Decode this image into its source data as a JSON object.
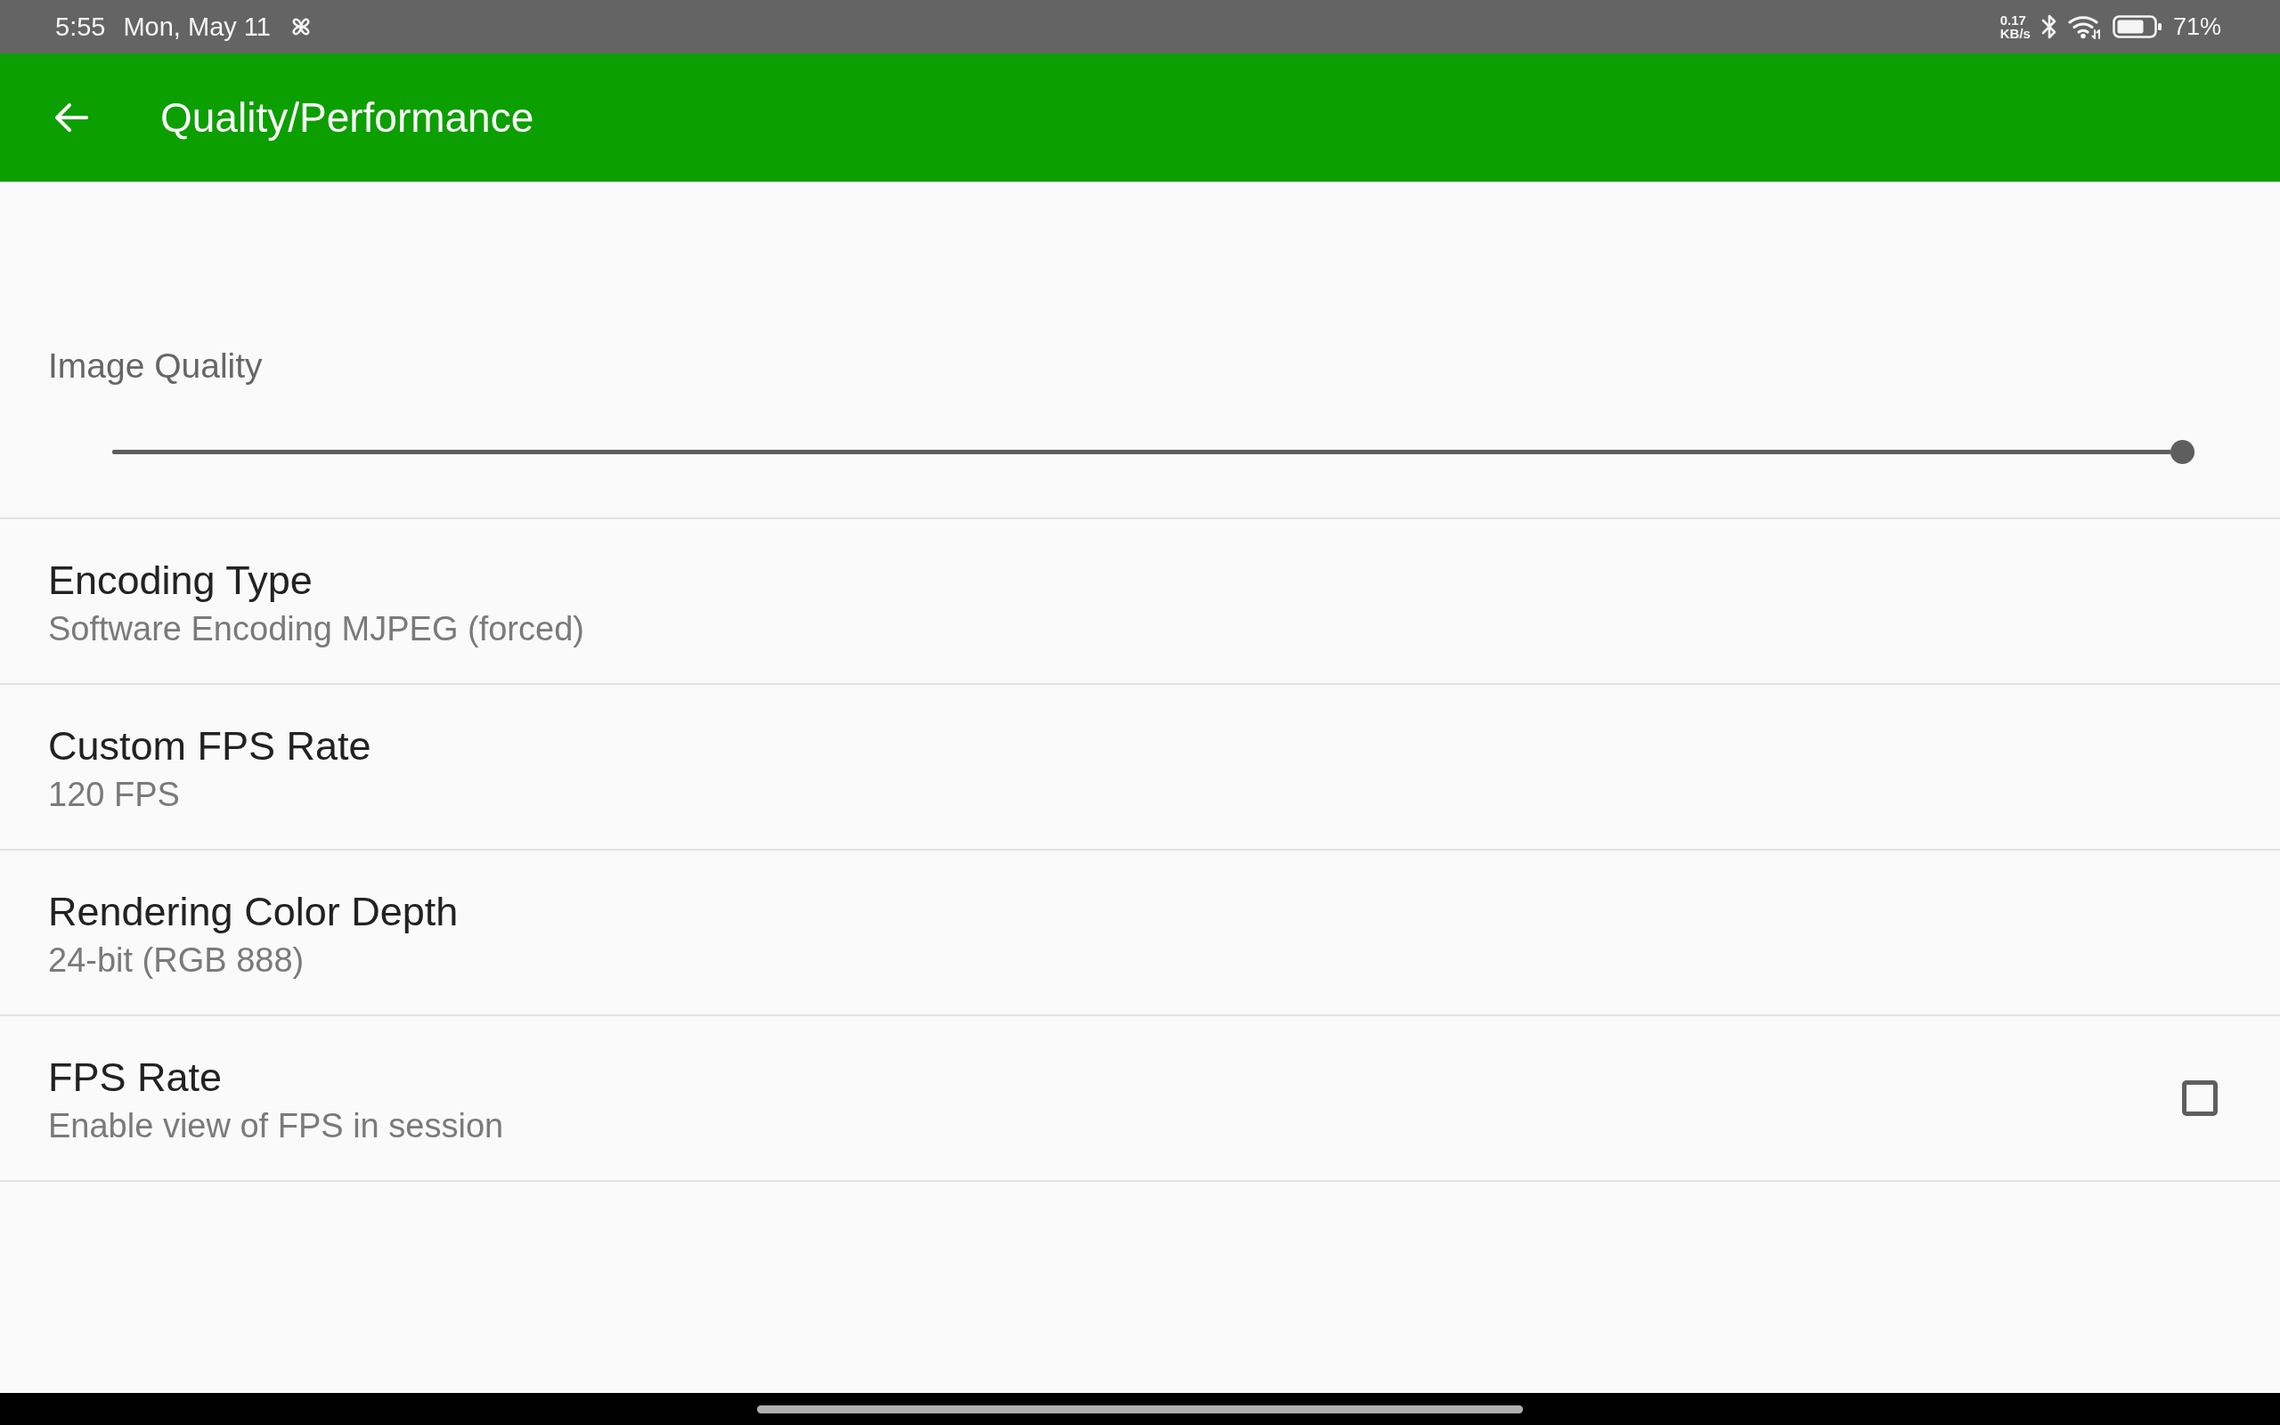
{
  "status_bar": {
    "time": "5:55",
    "date": "Mon, May 11",
    "net_speed_value": "0.17",
    "net_speed_unit": "KB/s",
    "battery_percent": "71%"
  },
  "app_bar": {
    "title": "Quality/Performance"
  },
  "settings": [
    {
      "kind": "slider",
      "label": "Image Quality",
      "level": 1
    },
    {
      "kind": "text",
      "title": "Encoding Type",
      "summary": "Software Encoding MJPEG (forced)"
    },
    {
      "kind": "text",
      "title": "Custom FPS Rate",
      "summary": "120 FPS"
    },
    {
      "kind": "text",
      "title": "Rendering Color Depth",
      "summary": "24-bit (RGB 888)"
    },
    {
      "kind": "checkbox",
      "title": "FPS Rate",
      "summary": "Enable view of FPS in session",
      "checked": false
    }
  ]
}
